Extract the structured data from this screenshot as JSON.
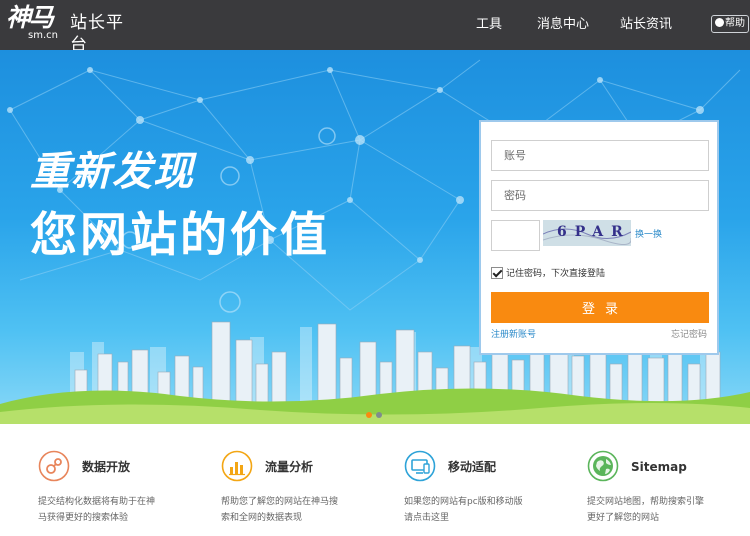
{
  "header": {
    "logo_glyph": "神马",
    "logo_sub": "sm.cn",
    "logo_title": "站长平台",
    "nav": [
      {
        "label": "工具"
      },
      {
        "label": "消息中心"
      },
      {
        "label": "站长资讯"
      }
    ],
    "help_label": "帮助"
  },
  "banner": {
    "headline_1": "重新发现",
    "headline_2": "您网站的价值",
    "carousel_active_color": "#f98a10",
    "carousel_inactive_color": "#7f8c8d"
  },
  "login": {
    "account_placeholder": "账号",
    "password_placeholder": "密码",
    "captcha_placeholder": "",
    "captcha_text": "6PAR",
    "refresh_label": "换一换",
    "remember_label": "记住密码，下次直接登陆",
    "remember_checked": true,
    "submit_label": "登录",
    "register_label": "注册新账号",
    "forgot_label": "忘记密码"
  },
  "features": [
    {
      "title": "数据开放",
      "desc": "提交结构化数据将有助于在神马获得更好的搜索体验",
      "icon": "data-open-icon",
      "color": "#e8855b"
    },
    {
      "title": "流量分析",
      "desc": "帮助您了解您的网站在神马搜索和全网的数据表现",
      "icon": "bar-chart-icon",
      "color": "#f3a614"
    },
    {
      "title": "移动适配",
      "desc": "如果您的网站有pc版和移动版请点击这里",
      "icon": "devices-icon",
      "color": "#2ea3d8"
    },
    {
      "title": "Sitemap",
      "desc": "提交网站地图，帮助搜索引擎更好了解您的网站",
      "icon": "globe-icon",
      "color": "#5bb55b"
    }
  ],
  "colors": {
    "header_bg": "#3a3a3d",
    "accent_orange": "#f98a10",
    "link_blue": "#2b8ac9"
  }
}
